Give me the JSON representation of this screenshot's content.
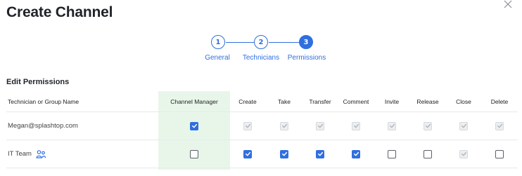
{
  "dialog": {
    "title": "Create Channel",
    "close_icon": "close-icon"
  },
  "stepper": {
    "steps": [
      {
        "number": "1",
        "label": "General",
        "state": "complete"
      },
      {
        "number": "2",
        "label": "Technicians",
        "state": "complete"
      },
      {
        "number": "3",
        "label": "Permissions",
        "state": "active"
      }
    ]
  },
  "permissions": {
    "section_title": "Edit Permissions",
    "columns": [
      "Technician or Group Name",
      "Channel Manager",
      "Create",
      "Take",
      "Transfer",
      "Comment",
      "Invite",
      "Release",
      "Close",
      "Delete"
    ],
    "rows": [
      {
        "name": "Megan@splashtop.com",
        "icon": null,
        "values": [
          "checked",
          "disabled",
          "disabled",
          "disabled",
          "disabled",
          "disabled",
          "disabled",
          "disabled",
          "disabled"
        ]
      },
      {
        "name": "IT Team",
        "icon": "group-icon",
        "values": [
          "unchecked",
          "checked",
          "checked",
          "checked",
          "checked",
          "unchecked",
          "unchecked",
          "disabled",
          "unchecked"
        ]
      }
    ]
  },
  "colors": {
    "accent": "#2f6fe0",
    "channel_manager_bg": "#e8f6ea",
    "disabled_checkbox": "#eceef0"
  }
}
